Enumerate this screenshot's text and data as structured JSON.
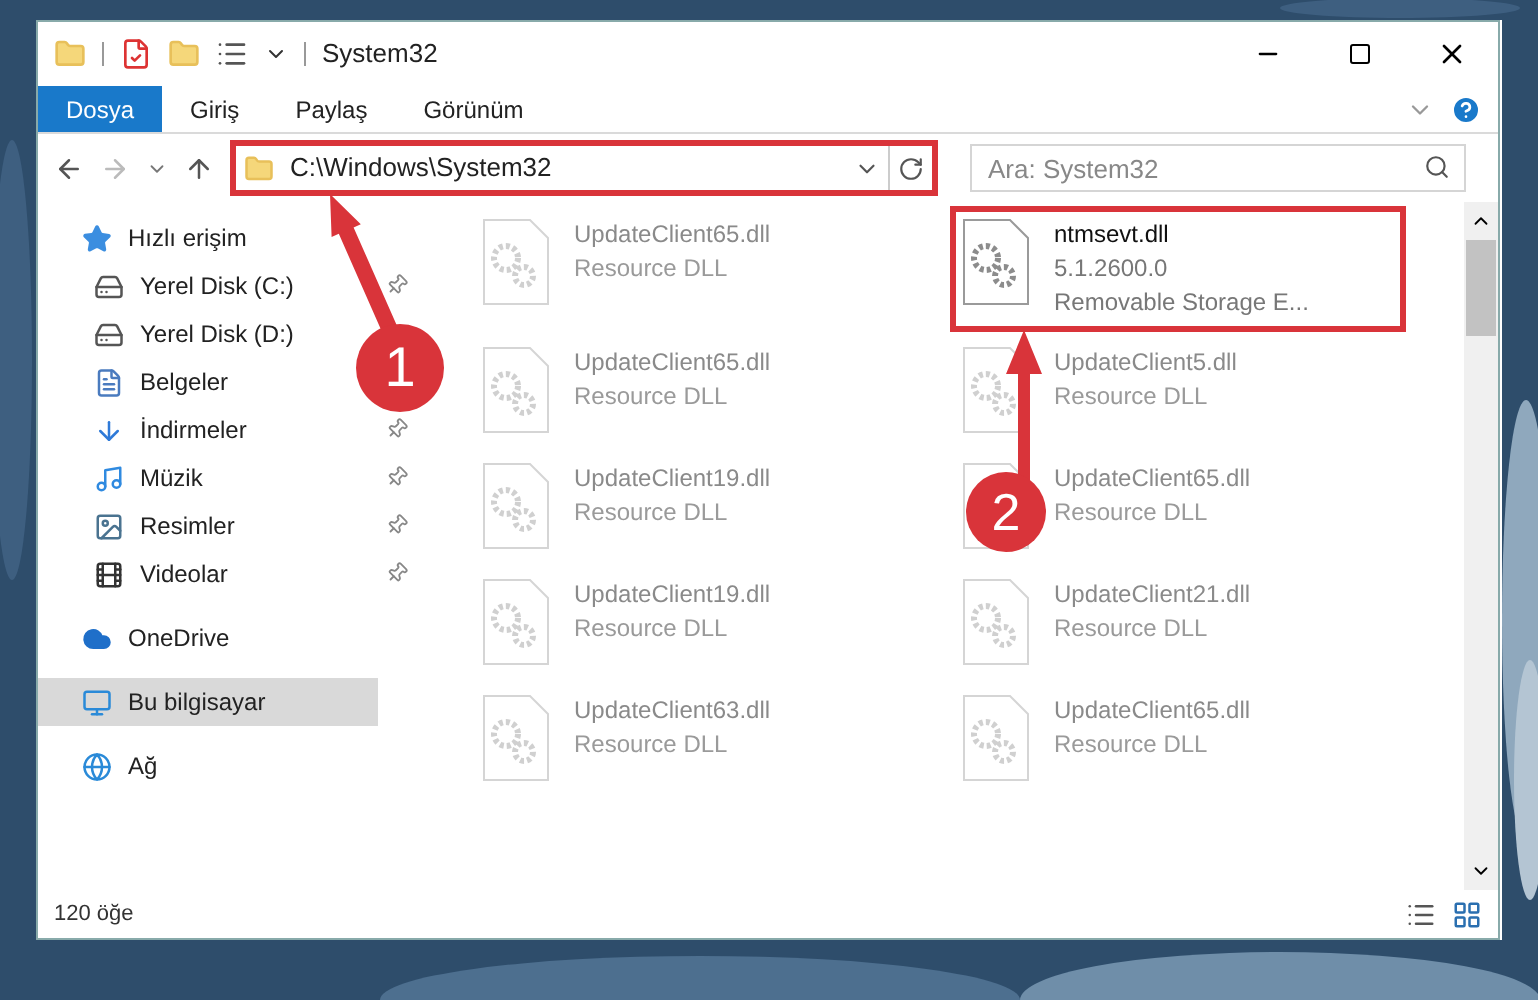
{
  "window": {
    "title": "System32"
  },
  "ribbon_tabs": [
    {
      "label": "Dosya",
      "selected": true
    },
    {
      "label": "Giriş",
      "selected": false
    },
    {
      "label": "Paylaş",
      "selected": false
    },
    {
      "label": "Görünüm",
      "selected": false
    }
  ],
  "address": {
    "path": "C:\\Windows\\System32",
    "highlighted": true
  },
  "search": {
    "placeholder": "Ara: System32"
  },
  "sidebar": {
    "items": [
      {
        "label": "Hızlı erişim",
        "kind": "star",
        "selected": false,
        "children": [
          {
            "label": "Yerel Disk (C:)",
            "kind": "drive",
            "pinned": true,
            "selected": false
          },
          {
            "label": "Yerel Disk (D:)",
            "kind": "drive",
            "pinned": false,
            "selected": false
          },
          {
            "label": "Belgeler",
            "kind": "document",
            "pinned": false,
            "selected": false
          },
          {
            "label": "İndirmeler",
            "kind": "download",
            "pinned": true,
            "selected": false
          },
          {
            "label": "Müzik",
            "kind": "music",
            "pinned": true,
            "selected": false
          },
          {
            "label": "Resimler",
            "kind": "pictures",
            "pinned": true,
            "selected": false
          },
          {
            "label": "Videolar",
            "kind": "video",
            "pinned": true,
            "selected": false
          }
        ]
      },
      {
        "label": "OneDrive",
        "kind": "cloud",
        "selected": false
      },
      {
        "label": "Bu bilgisayar",
        "kind": "computer",
        "selected": true
      },
      {
        "label": "Ağ",
        "kind": "network",
        "selected": false
      }
    ]
  },
  "files": [
    {
      "name": "UpdateClient65.dll",
      "details": [
        "Resource DLL"
      ],
      "blurred": true,
      "highlighted": false
    },
    {
      "name": "ntmsevt.dll",
      "details": [
        "5.1.2600.0",
        "Removable Storage E..."
      ],
      "blurred": false,
      "highlighted": true
    },
    {
      "name": "UpdateClient65.dll",
      "details": [
        "Resource DLL"
      ],
      "blurred": true,
      "highlighted": false
    },
    {
      "name": "UpdateClient5.dll",
      "details": [
        "Resource DLL"
      ],
      "blurred": true,
      "highlighted": false
    },
    {
      "name": "UpdateClient19.dll",
      "details": [
        "Resource DLL"
      ],
      "blurred": true,
      "highlighted": false
    },
    {
      "name": "UpdateClient65.dll",
      "details": [
        "Resource DLL"
      ],
      "blurred": true,
      "highlighted": false
    },
    {
      "name": "UpdateClient19.dll",
      "details": [
        "Resource DLL"
      ],
      "blurred": true,
      "highlighted": false
    },
    {
      "name": "UpdateClient21.dll",
      "details": [
        "Resource DLL"
      ],
      "blurred": true,
      "highlighted": false
    },
    {
      "name": "UpdateClient63.dll",
      "details": [
        "Resource DLL"
      ],
      "blurred": true,
      "highlighted": false
    },
    {
      "name": "UpdateClient65.dll",
      "details": [
        "Resource DLL"
      ],
      "blurred": true,
      "highlighted": false
    }
  ],
  "status_bar": {
    "count": "120 öğe"
  },
  "annotations": [
    {
      "number": "1"
    },
    {
      "number": "2"
    }
  ]
}
